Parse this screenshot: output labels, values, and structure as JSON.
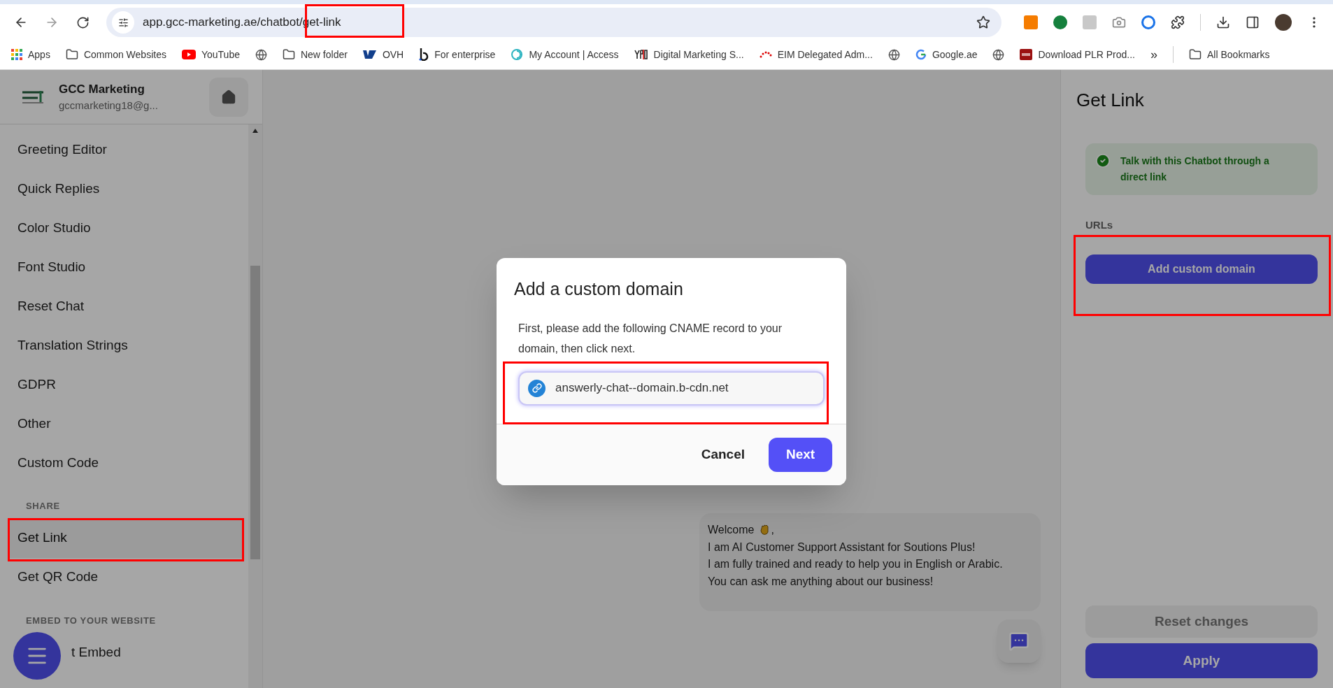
{
  "browser": {
    "url": "app.gcc-marketing.ae/chatbot/get-link",
    "bookmarks": [
      {
        "kind": "apps",
        "label": "Apps"
      },
      {
        "kind": "folder",
        "label": "Common Websites"
      },
      {
        "kind": "youtube",
        "label": "YouTube"
      },
      {
        "kind": "globe"
      },
      {
        "kind": "folder",
        "label": "New folder"
      },
      {
        "kind": "ovh",
        "label": "OVH"
      },
      {
        "kind": "b",
        "label": "For enterprise"
      },
      {
        "kind": "swirl",
        "label": "My Account | Access"
      },
      {
        "kind": "ypo",
        "label": "Digital Marketing S..."
      },
      {
        "kind": "dots",
        "label": "EIM Delegated Adm..."
      },
      {
        "kind": "globe"
      },
      {
        "kind": "google",
        "label": "Google.ae"
      },
      {
        "kind": "globe"
      },
      {
        "kind": "plr",
        "label": "Download PLR Prod..."
      }
    ],
    "more": "»",
    "all_bookmarks": "All Bookmarks"
  },
  "sidebar": {
    "account": {
      "name": "GCC Marketing",
      "email": "gccmarketing18@g..."
    },
    "sections": [
      {
        "items": [
          {
            "label": "Greeting Editor",
            "selected": false
          },
          {
            "label": "Quick Replies",
            "selected": false
          },
          {
            "label": "Color Studio",
            "selected": false
          },
          {
            "label": "Font Studio",
            "selected": false
          },
          {
            "label": "Reset Chat",
            "selected": false
          },
          {
            "label": "Translation Strings",
            "selected": false
          },
          {
            "label": "GDPR",
            "selected": false
          },
          {
            "label": "Other",
            "selected": false
          },
          {
            "label": "Custom Code",
            "selected": false
          }
        ]
      },
      {
        "heading": "SHARE",
        "items": [
          {
            "label": "Get Link",
            "selected": true
          },
          {
            "label": "Get QR Code",
            "selected": false
          }
        ]
      },
      {
        "heading": "EMBED TO YOUR WEBSITE",
        "items": [
          {
            "label": "t Embed",
            "selected": false
          }
        ]
      }
    ]
  },
  "chat": {
    "greeting": {
      "before": "Welcome",
      "after": ","
    },
    "lines": [
      "I am AI Customer Support Assistant for Soutions Plus!",
      "I am fully trained and ready to help you in English or Arabic.",
      "You can ask me anything about our business!"
    ]
  },
  "panel": {
    "title": "Get Link",
    "alert": "Talk with this Chatbot through a direct link",
    "urls_label": "URLs",
    "add_button": "Add custom domain",
    "reset_button": {
      "label": "Reset changes",
      "disabled": true
    },
    "apply_button": "Apply"
  },
  "modal": {
    "title": "Add a custom domain",
    "body": "First, please add the following CNAME record to your domain, then click next.",
    "field_value": "answerly-chat--domain.b-cdn.net",
    "cancel": "Cancel",
    "next": "Next"
  }
}
